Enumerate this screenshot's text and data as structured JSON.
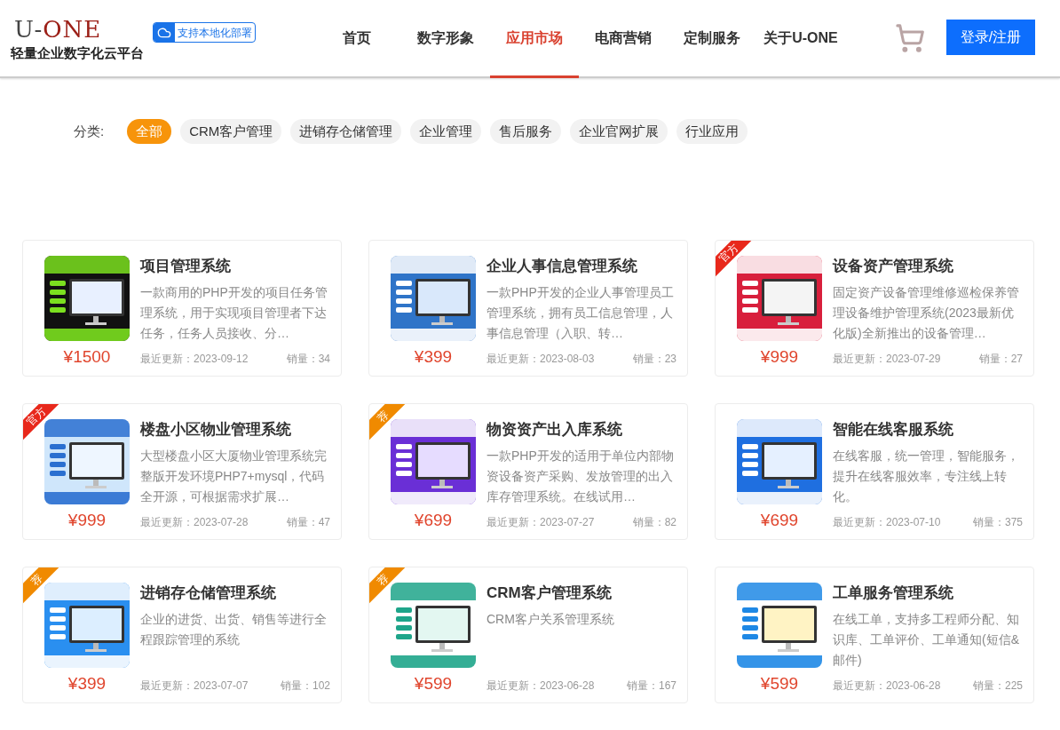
{
  "header": {
    "logo": {
      "prefix": "U-",
      "suffix": "ONE"
    },
    "slogan": "轻量企业数字化云平台",
    "deploy_badge": "支持本地化部署",
    "nav": [
      {
        "label": "首页",
        "selected": false
      },
      {
        "label": "数字形象",
        "selected": false
      },
      {
        "label": "应用市场",
        "selected": true
      },
      {
        "label": "电商营销",
        "selected": false
      },
      {
        "label": "定制服务",
        "selected": false
      },
      {
        "label": "关于U-ONE",
        "selected": false
      }
    ],
    "login_button": "登录/注册"
  },
  "categories": {
    "label": "分类:",
    "items": [
      {
        "label": "全部",
        "selected": true
      },
      {
        "label": "CRM客户管理",
        "selected": false
      },
      {
        "label": "进销存仓储管理",
        "selected": false
      },
      {
        "label": "企业管理",
        "selected": false
      },
      {
        "label": "售后服务",
        "selected": false
      },
      {
        "label": "企业官网扩展",
        "selected": false
      },
      {
        "label": "行业应用",
        "selected": false
      }
    ]
  },
  "products": [
    {
      "title": "项目管理系统",
      "description": "一款商用的PHP开发的项目任务管理系统，用于实现项目管理者下达任务，任务人员接收、分…",
      "price": "¥1500",
      "updated": "最近更新：2023-09-12",
      "sales": "销量：34"
    },
    {
      "title": "企业人事信息管理系统",
      "description": "一款PHP开发的企业人事管理员工管理系统，拥有员工信息管理，人事信息管理（入职、转…",
      "price": "¥399",
      "updated": "最近更新：2023-08-03",
      "sales": "销量：23"
    },
    {
      "title": "设备资产管理系统",
      "description": "固定资产设备管理维修巡检保养管理设备维护管理系统(2023最新优化版)全新推出的设备管理…",
      "price": "¥999",
      "updated": "最近更新：2023-07-29",
      "sales": "销量：27",
      "ribbon": {
        "text": "官方",
        "kind": "official"
      }
    },
    {
      "title": "楼盘小区物业管理系统",
      "description": "大型楼盘小区大厦物业管理系统完整版开发环境PHP7+mysql，代码全开源，可根据需求扩展…",
      "price": "¥999",
      "updated": "最近更新：2023-07-28",
      "sales": "销量：47",
      "ribbon": {
        "text": "官方",
        "kind": "official"
      }
    },
    {
      "title": "物资资产出入库系统",
      "description": "一款PHP开发的适用于单位内部物资设备资产采购、发放管理的出入库存管理系统。在线试用…",
      "price": "¥699",
      "updated": "最近更新：2023-07-27",
      "sales": "销量：82",
      "ribbon": {
        "text": "荐",
        "kind": "recommended"
      }
    },
    {
      "title": "智能在线客服系统",
      "description": "在线客服，统一管理，智能服务，提升在线客服效率，专注线上转化。",
      "price": "¥699",
      "updated": "最近更新：2023-07-10",
      "sales": "销量：375"
    },
    {
      "title": "进销存仓储管理系统",
      "description": "企业的进货、出货、销售等进行全程跟踪管理的系统",
      "price": "¥399",
      "updated": "最近更新：2023-07-07",
      "sales": "销量：102",
      "ribbon": {
        "text": "荐",
        "kind": "recommended"
      }
    },
    {
      "title": "CRM客户管理系统",
      "description": "CRM客户关系管理系统",
      "price": "¥599",
      "updated": "最近更新：2023-06-28",
      "sales": "销量：167",
      "ribbon": {
        "text": "荐",
        "kind": "recommended"
      }
    },
    {
      "title": "工单服务管理系统",
      "description": "在线工单，支持多工程师分配、知识库、工单评价、工单通知(短信&邮件)",
      "price": "¥599",
      "updated": "最近更新：2023-06-28",
      "sales": "销量：225"
    }
  ]
}
